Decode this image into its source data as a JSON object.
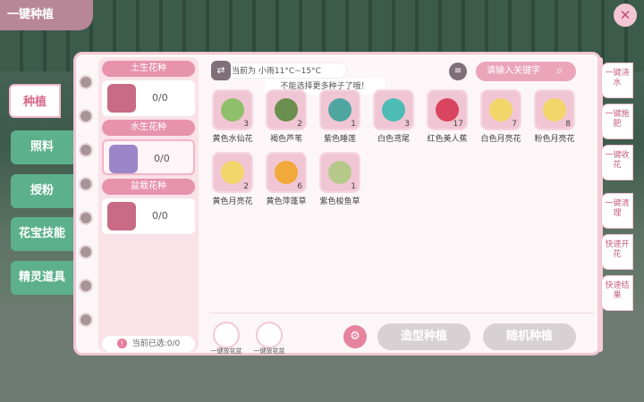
{
  "title": "一键种植",
  "close_icon": "close-icon",
  "tabs": [
    "种植",
    "照料",
    "授粉",
    "花宝技能",
    "精灵道具"
  ],
  "categories": [
    {
      "head": "土生花种",
      "count": "0/0"
    },
    {
      "head": "水生花种",
      "count": "0/0"
    },
    {
      "head": "盆栽花种",
      "count": "0/0"
    }
  ],
  "selected_info": "当前已选:0/0",
  "weather": "当前为 小雨11°C~15°C",
  "toast": "不能选择更多种子了哦！",
  "search_placeholder": "请输入关键字",
  "seeds": [
    {
      "name": "黄色水仙花",
      "qty": "3",
      "color": "#8fbf6a"
    },
    {
      "name": "褐色芦苇",
      "qty": "2",
      "color": "#6b8f4e"
    },
    {
      "name": "紫色睡莲",
      "qty": "1",
      "color": "#4fa6a0"
    },
    {
      "name": "白色鸢尾",
      "qty": "3",
      "color": "#4cbcb4"
    },
    {
      "name": "红色美人蕉",
      "qty": "17",
      "color": "#d9445e"
    },
    {
      "name": "白色月亮花",
      "qty": "7",
      "color": "#f2d66a"
    },
    {
      "name": "粉色月亮花",
      "qty": "8",
      "color": "#f2d66a"
    },
    {
      "name": "黄色月亮花",
      "qty": "2",
      "color": "#f2d66a"
    },
    {
      "name": "黄色萍蓬草",
      "qty": "6",
      "color": "#f0a93a"
    },
    {
      "name": "紫色梭鱼草",
      "qty": "1",
      "color": "#b6c98b"
    }
  ],
  "pots": [
    "一键放花盆",
    "一键放花盆"
  ],
  "buttons": {
    "shape_plant": "造型种植",
    "random_plant": "随机种植"
  },
  "right_tools": [
    "一键浇水",
    "一键施肥",
    "一键收花",
    "一键清理",
    "快速开花",
    "快速结果"
  ]
}
